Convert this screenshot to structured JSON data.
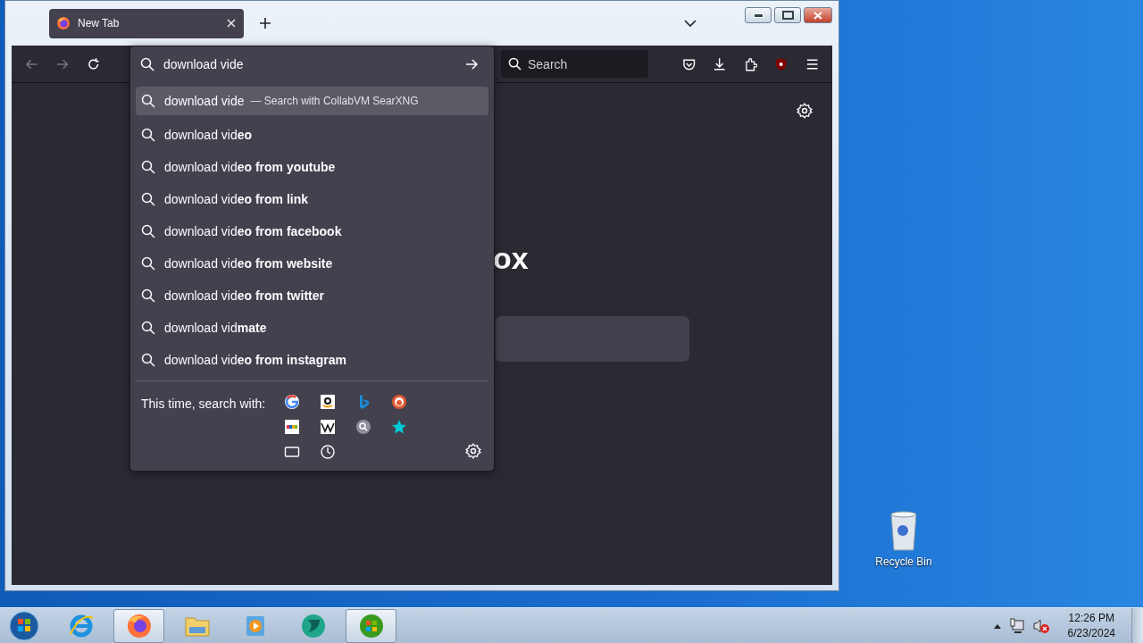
{
  "browser": {
    "tabs": [
      {
        "title": "New Tab",
        "selected": true
      }
    ],
    "urlbar": {
      "value": "download vide"
    },
    "search_field": {
      "placeholder": "Search"
    },
    "new_tab_page": {
      "logo_text": "ox"
    }
  },
  "dropdown": {
    "suggestions": [
      {
        "text": "download vide",
        "action": "— Search with CollabVM SearXNG",
        "selected": true
      },
      {
        "text": "download vid**eo**",
        "selected": false
      },
      {
        "text": "download vid**eo from youtube**",
        "selected": false
      },
      {
        "text": "download vid**eo from link**",
        "selected": false
      },
      {
        "text": "download vid**eo from facebook**",
        "selected": false
      },
      {
        "text": "download vid**eo from website**",
        "selected": false
      },
      {
        "text": "download vid**eo from twitter**",
        "selected": false
      },
      {
        "text": "download vid**mate**",
        "selected": false
      },
      {
        "text": "download vid**eo from instagram**",
        "selected": false
      }
    ],
    "engines_label": "This time, search with:"
  },
  "desktop_icons": [
    {
      "label": "Recycle Bin"
    }
  ],
  "taskbar": {
    "apps": [
      {
        "kind": "ie",
        "selected": false
      },
      {
        "kind": "firefox",
        "selected": true
      },
      {
        "kind": "folder",
        "selected": false
      },
      {
        "kind": "media",
        "selected": false
      },
      {
        "kind": "globe",
        "selected": false
      },
      {
        "kind": "windows",
        "selected": true
      }
    ],
    "clock": {
      "time": "12:26 PM",
      "date": "6/23/2024"
    }
  }
}
